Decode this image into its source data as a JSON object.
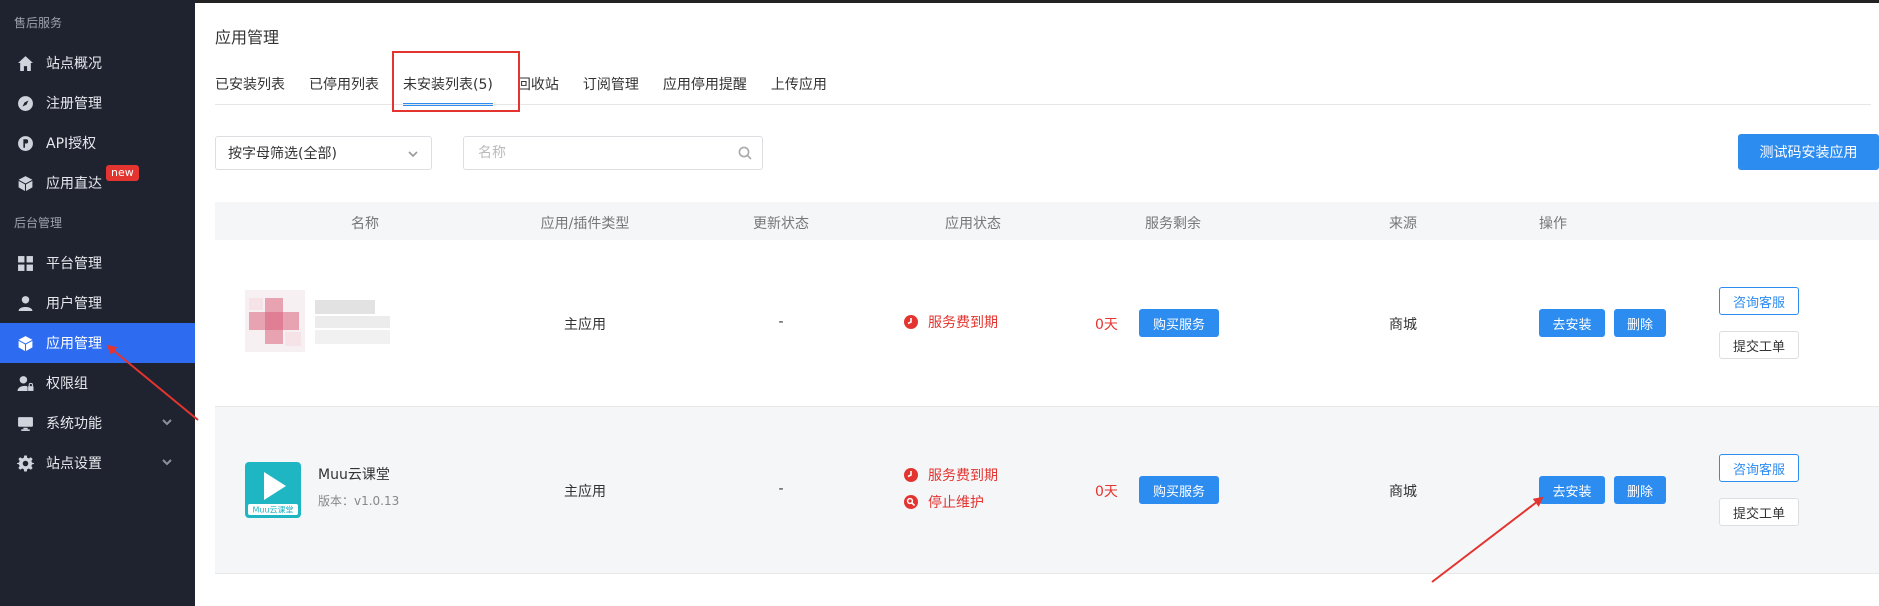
{
  "sidebar": {
    "section1": "售后服务",
    "section2": "后台管理",
    "items": [
      {
        "label": "站点概况"
      },
      {
        "label": "注册管理"
      },
      {
        "label": "API授权"
      },
      {
        "label": "应用直达",
        "badge": "new"
      },
      {
        "label": "平台管理"
      },
      {
        "label": "用户管理"
      },
      {
        "label": "应用管理"
      },
      {
        "label": "权限组"
      },
      {
        "label": "系统功能"
      },
      {
        "label": "站点设置"
      }
    ]
  },
  "main": {
    "title": "应用管理",
    "tabs": [
      "已安装列表",
      "已停用列表",
      "未安装列表(5)",
      "回收站",
      "订阅管理",
      "应用停用提醒",
      "上传应用"
    ],
    "active_tab": "未安装列表(5)",
    "filter": {
      "selected": "按字母筛选(全部)"
    },
    "search": {
      "placeholder": "名称"
    },
    "test_install_button": "测试码安装应用",
    "table": {
      "headers": [
        "名称",
        "应用/插件类型",
        "更新状态",
        "应用状态",
        "服务剩余",
        "来源",
        "操作"
      ],
      "rows": [
        {
          "name": "",
          "version": "",
          "type": "主应用",
          "update_status": "-",
          "statuses": [
            "服务费到期"
          ],
          "days": "0天",
          "buy_button": "购买服务",
          "source": "商城",
          "install_button": "去安装",
          "delete_button": "删除",
          "consult_button": "咨询客服",
          "ticket_button": "提交工单"
        },
        {
          "name": "Muu云课堂",
          "version": "版本：v1.0.13",
          "logo_text": "Muu云课堂",
          "type": "主应用",
          "update_status": "-",
          "statuses": [
            "服务费到期",
            "停止维护"
          ],
          "days": "0天",
          "buy_button": "购买服务",
          "source": "商城",
          "install_button": "去安装",
          "delete_button": "删除",
          "consult_button": "咨询客服",
          "ticket_button": "提交工单"
        }
      ]
    }
  },
  "colors": {
    "sidebar_bg": "#1f2330",
    "active_nav": "#2d6cf0",
    "primary": "#2d8cf0",
    "danger": "#e3342f",
    "logo_teal": "#1fb6c4"
  }
}
